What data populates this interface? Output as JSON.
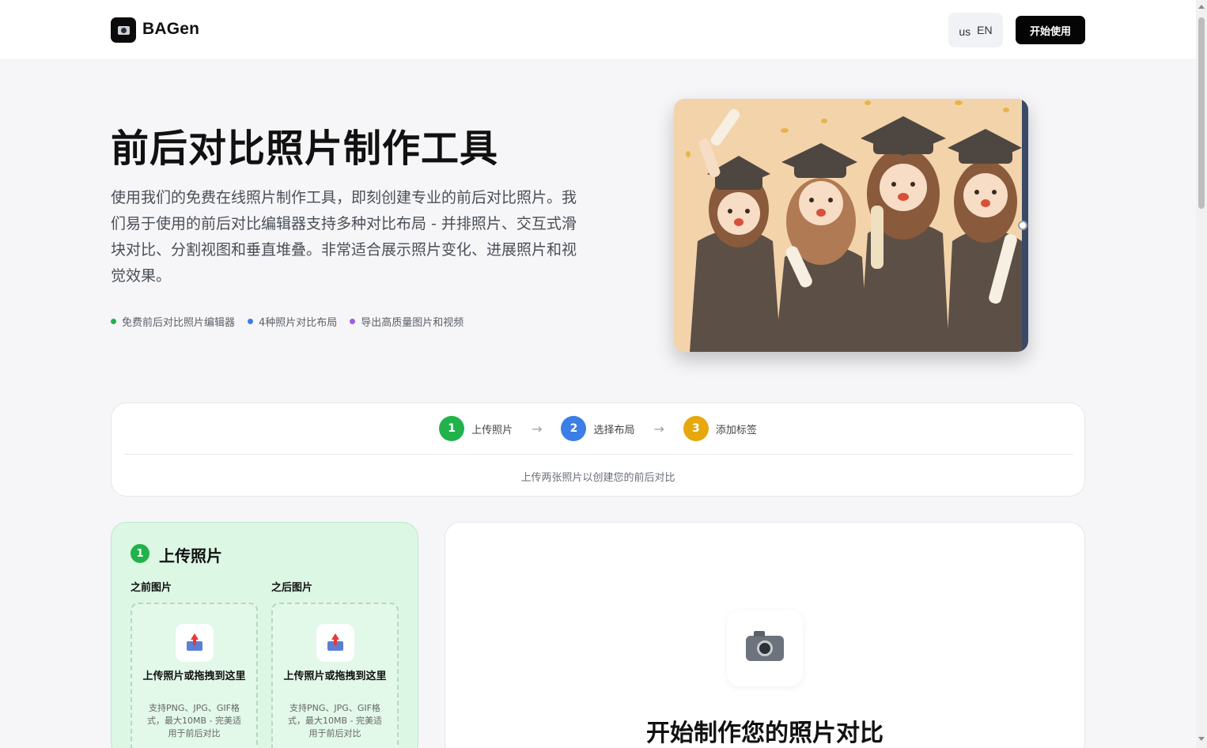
{
  "header": {
    "brand": "BAGen",
    "lang_flag": "us",
    "lang_label": "EN",
    "start_label": "开始使用"
  },
  "hero": {
    "title": "前后对比照片制作工具",
    "description": "使用我们的免费在线照片制作工具，即刻创建专业的前后对比照片。我们易于使用的前后对比编辑器支持多种对比布局 - 并排照片、交互式滑块对比、分割视图和垂直堆叠。非常适合展示照片变化、进展照片和视觉效果。",
    "features": [
      {
        "label": "免费前后对比照片编辑器",
        "color": "#22b24c"
      },
      {
        "label": "4种照片对比布局",
        "color": "#3b7ee6"
      },
      {
        "label": "导出高质量图片和视频",
        "color": "#a35be0"
      }
    ]
  },
  "steps": {
    "items": [
      {
        "num": "1",
        "label": "上传照片",
        "color": "#22b24c"
      },
      {
        "num": "2",
        "label": "选择布局",
        "color": "#3b7ee6"
      },
      {
        "num": "3",
        "label": "添加标签",
        "color": "#e6a80c"
      }
    ],
    "arrow": "→",
    "hint": "上传两张照片以创建您的前后对比"
  },
  "upload": {
    "num": "1",
    "title": "上传照片",
    "before_label": "之前图片",
    "after_label": "之后图片",
    "dropzone_main": "上传照片或拖拽到这里",
    "dropzone_sub": "支持PNG、JPG、GIF格式，最大10MB - 完美适用于前后对比"
  },
  "preview": {
    "title": "开始制作您的照片对比"
  }
}
